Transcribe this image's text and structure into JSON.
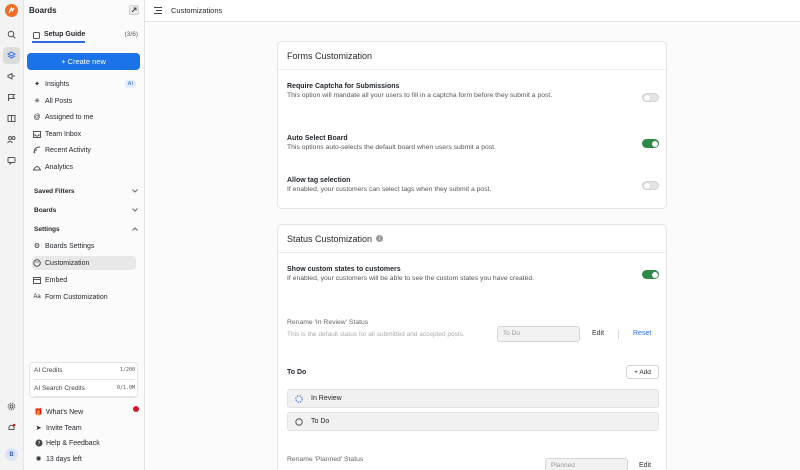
{
  "sidebar": {
    "title": "Boards",
    "setup_guide": {
      "label": "Setup Guide",
      "count": "(3/6)",
      "progress": 0.5
    },
    "create_label": "+ Create new",
    "nav": [
      {
        "label": "Insights",
        "icon": "sparkle-icon",
        "badge": "AI"
      },
      {
        "label": "All Posts",
        "icon": "asterisk-icon"
      },
      {
        "label": "Assigned to me",
        "icon": "at-icon"
      },
      {
        "label": "Team Inbox",
        "icon": "inbox-icon"
      },
      {
        "label": "Recent Activity",
        "icon": "activity-icon"
      },
      {
        "label": "Analytics",
        "icon": "analytics-icon"
      }
    ],
    "sections": {
      "saved_filters": "Saved Filters",
      "boards": "Boards",
      "settings": "Settings"
    },
    "settings_items": [
      {
        "label": "Boards Settings",
        "icon": "gear-icon"
      },
      {
        "label": "Customization",
        "icon": "palette-icon",
        "selected": true
      },
      {
        "label": "Embed",
        "icon": "embed-icon"
      },
      {
        "label": "Form Customization",
        "icon": "text-icon"
      }
    ],
    "credits": {
      "ai_credits_label": "AI Credits",
      "ai_credits_value": "1/200",
      "ai_search_label": "AI Search Credits",
      "ai_search_value": "0/1.0M"
    },
    "footer": {
      "whats_new": "What's New",
      "invite_team": "Invite Team",
      "help": "Help & Feedback",
      "trial": "13 days left"
    }
  },
  "rail": {
    "avatar_initial": "B"
  },
  "topbar": {
    "breadcrumb": "Customizations"
  },
  "forms": {
    "title": "Forms Customization",
    "options": [
      {
        "title": "Require Captcha for Submissions",
        "desc": "This option will mandate all your users to fill in a captcha form before they submit a post.",
        "enabled": false
      },
      {
        "title": "Auto Select Board",
        "desc": "This options auto-selects the default board when users submit a post.",
        "enabled": true
      },
      {
        "title": "Allow tag selection",
        "desc": "If enabled, your customers can select tags when they submit a post.",
        "enabled": false
      }
    ]
  },
  "status": {
    "title": "Status Customization",
    "info_icon": "i",
    "show_custom": {
      "title": "Show custom states to customers",
      "desc": "If enabled, your customers will be able to see the custom states you have created.",
      "enabled": true
    },
    "rename_in_review": {
      "title": "Rename 'In Review' Status",
      "desc": "This is the default status for all submitted and accepted posts.",
      "placeholder": "To Do",
      "edit": "Edit",
      "reset": "Reset"
    },
    "todo_group": {
      "title": "To Do",
      "add": "+ Add",
      "states": [
        "In Review",
        "To Do"
      ]
    },
    "rename_planned": {
      "title": "Rename 'Planned' Status",
      "placeholder": "Planned",
      "edit": "Edit"
    }
  }
}
